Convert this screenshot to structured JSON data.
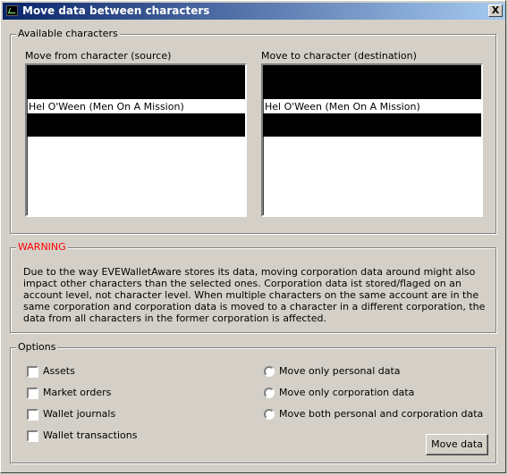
{
  "window": {
    "title": "Move data between characters",
    "close_label": "X"
  },
  "available": {
    "group_label": "Available characters",
    "source": {
      "label": "Move from character (source)",
      "items": [
        "",
        "",
        "Hel O'Ween (Men On A Mission)",
        ""
      ]
    },
    "destination": {
      "label": "Move to character (destination)",
      "items": [
        "",
        "",
        "Hel O'Ween (Men On A Mission)",
        ""
      ]
    }
  },
  "warning": {
    "group_label": "WARNING",
    "text": "Due to the way EVEWalletAware stores its data, moving corporation data around might also impact other characters than the selected ones. Corporation data ist stored/flaged on an account level, not character level. When multiple characters on the same account are in the same corporation and corporation data is moved to a character in a different corporation, the data from all characters in the former corporation is affected."
  },
  "options": {
    "group_label": "Options",
    "checkboxes": [
      {
        "label": "Assets",
        "checked": false
      },
      {
        "label": "Market orders",
        "checked": false
      },
      {
        "label": "Wallet journals",
        "checked": false
      },
      {
        "label": "Wallet transactions",
        "checked": false
      }
    ],
    "radios": [
      {
        "label": "Move only personal data",
        "selected": false
      },
      {
        "label": "Move only corporation data",
        "selected": false
      },
      {
        "label": "Move both personal and corporation data",
        "selected": false
      }
    ],
    "move_button_label": "Move data"
  },
  "colors": {
    "title_start": "#0a246a",
    "title_end": "#a6caf0",
    "warning": "#ff0000",
    "dialog_bg": "#d4d0c8"
  }
}
